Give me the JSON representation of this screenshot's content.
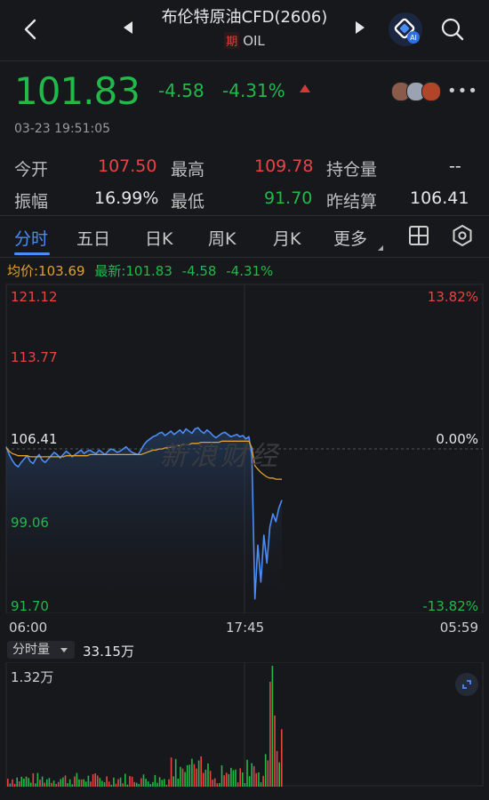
{
  "header": {
    "title": "布伦特原油CFD(2606)",
    "sub_badge": "期",
    "sub_code": "OIL",
    "ai_label": "AI"
  },
  "quote": {
    "price": "101.83",
    "change": "-4.58",
    "change_pct": "-4.31%",
    "timestamp": "03-23 19:51:05"
  },
  "stats": {
    "open_label": "今开",
    "open_value": "107.50",
    "high_label": "最高",
    "high_value": "109.78",
    "oi_label": "持仓量",
    "oi_value": "--",
    "amp_label": "振幅",
    "amp_value": "16.99%",
    "low_label": "最低",
    "low_value": "91.70",
    "prev_label": "昨结算",
    "prev_value": "106.41"
  },
  "tabs": [
    "分时",
    "五日",
    "日K",
    "周K",
    "月K",
    "更多"
  ],
  "info_bar": {
    "avg": "均价:103.69",
    "latest": "最新:101.83",
    "change": "-4.58",
    "change_pct": "-4.31%"
  },
  "axis": {
    "y_left": [
      "121.12",
      "113.77",
      "106.41",
      "99.06",
      "91.70"
    ],
    "y_right_top": "13.82%",
    "y_right_mid": "0.00%",
    "y_right_bottom": "-13.82%",
    "x_ticks": [
      "06:00",
      "17:45",
      "05:59"
    ]
  },
  "watermark": "新浪财经",
  "volume": {
    "selector_label": "分时量",
    "total": "33.15万",
    "max_label": "1.32万"
  },
  "colors": {
    "up": "#e64545",
    "down": "#20b94a",
    "price_line": "#4b8cf5",
    "avg_line": "#e0a030",
    "accent": "#4b8cf5"
  },
  "chart_data": {
    "type": "line",
    "title": "",
    "xlabel": "",
    "ylabel": "",
    "ylim": [
      91.7,
      121.12
    ],
    "x_ticks": [
      "06:00",
      "17:45",
      "05:59"
    ],
    "reference": 106.41,
    "series": [
      {
        "name": "最新",
        "color": "#4b8cf5",
        "values": [
          106.6,
          105.9,
          105.4,
          105.0,
          104.8,
          105.2,
          105.5,
          105.8,
          105.3,
          105.1,
          105.6,
          105.9,
          105.4,
          105.2,
          105.5,
          105.8,
          106.1,
          105.9,
          105.6,
          105.9,
          106.2,
          106.0,
          105.7,
          105.9,
          106.1,
          106.3,
          106.0,
          106.2,
          106.3,
          106.1,
          106.0,
          106.3,
          106.1,
          105.9,
          106.2,
          106.4,
          106.3,
          106.1,
          106.2,
          106.4,
          106.6,
          106.3,
          106.1,
          106.0,
          105.9,
          106.3,
          106.8,
          107.1,
          107.3,
          107.5,
          107.6,
          107.8,
          107.9,
          107.6,
          107.8,
          108.0,
          107.7,
          107.9,
          108.1,
          107.8,
          108.2,
          108.0,
          107.8,
          108.2,
          108.3,
          108.0,
          107.8,
          108.1,
          107.9,
          107.6,
          107.4,
          107.6,
          107.8,
          107.9,
          107.7,
          107.5,
          107.6,
          107.7,
          107.5,
          107.6,
          107.3,
          107.5,
          105.8,
          93.0,
          97.8,
          94.5,
          98.7,
          96.2,
          99.4,
          100.6,
          99.9,
          101.1,
          101.83
        ],
        "avg_values": [
          106.5,
          106.2,
          106.0,
          105.9,
          105.8,
          105.8,
          105.8,
          105.8,
          105.7,
          105.7,
          105.7,
          105.7,
          105.7,
          105.7,
          105.7,
          105.7,
          105.7,
          105.7,
          105.7,
          105.7,
          105.8,
          105.8,
          105.8,
          105.8,
          105.8,
          105.8,
          105.8,
          105.8,
          105.9,
          105.9,
          105.9,
          105.9,
          105.9,
          105.9,
          105.9,
          105.9,
          105.9,
          105.9,
          105.9,
          105.9,
          105.9,
          105.9,
          105.9,
          105.9,
          105.9,
          105.9,
          106.0,
          106.1,
          106.2,
          106.3,
          106.3,
          106.4,
          106.4,
          106.5,
          106.5,
          106.6,
          106.6,
          106.7,
          106.7,
          106.8,
          106.8,
          106.8,
          106.9,
          106.9,
          106.9,
          107.0,
          107.0,
          107.0,
          107.0,
          107.0,
          107.0,
          107.0,
          107.1,
          107.1,
          107.1,
          107.1,
          107.1,
          107.1,
          107.1,
          107.1,
          107.1,
          107.1,
          106.5,
          104.9,
          104.6,
          104.3,
          104.1,
          103.9,
          103.8,
          103.8,
          103.7,
          103.7,
          103.69
        ]
      }
    ],
    "volume_max": 13200
  }
}
